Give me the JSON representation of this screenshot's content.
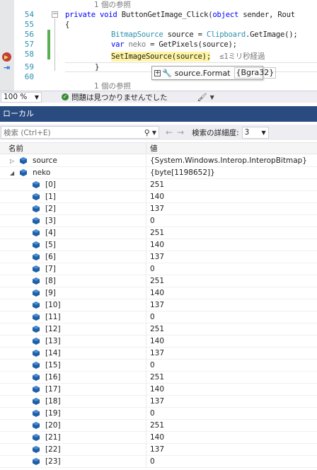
{
  "editor": {
    "ref_label_top": "1 個の参照",
    "ref_label_bottom": "1 個の参照",
    "line_numbers": [
      "54",
      "55",
      "56",
      "57",
      "58",
      "59",
      "60"
    ],
    "code": {
      "l54": {
        "kw1": "private",
        "kw2": "void",
        "name": " ButtonGetImage_Click(",
        "kw3": "object",
        "rest": " sender, Rout"
      },
      "l55": "{",
      "l56": {
        "type": "BitmapSource",
        "mid": " source = ",
        "type2": "Clipboard",
        "rest": ".GetImage();"
      },
      "l57": {
        "kw": "var",
        "dimvar": " neko",
        "rest": " = GetPixels(source);"
      },
      "l58": {
        "code": "SetImageSource(source);",
        "perf": "  ≤1ミリ秒経過"
      },
      "l59": "}"
    },
    "tooltip": {
      "expression": "source.Format",
      "value": "{Bgra32}"
    }
  },
  "status_bar": {
    "zoom": "100 %",
    "issues_text": "問題は見つかりませんでした"
  },
  "locals": {
    "title": "ローカル",
    "search_placeholder": "検索 (Ctrl+E)",
    "search_depth_label": "検索の詳細度:",
    "search_depth_value": "3",
    "columns": {
      "name": "名前",
      "value": "値"
    },
    "rows": [
      {
        "name": "source",
        "value": "{System.Windows.Interop.InteropBitmap}"
      },
      {
        "name": "neko",
        "value": "{byte[1198652]}"
      },
      {
        "name": "[0]",
        "value": "251"
      },
      {
        "name": "[1]",
        "value": "140"
      },
      {
        "name": "[2]",
        "value": "137"
      },
      {
        "name": "[3]",
        "value": "0"
      },
      {
        "name": "[4]",
        "value": "251"
      },
      {
        "name": "[5]",
        "value": "140"
      },
      {
        "name": "[6]",
        "value": "137"
      },
      {
        "name": "[7]",
        "value": "0"
      },
      {
        "name": "[8]",
        "value": "251"
      },
      {
        "name": "[9]",
        "value": "140"
      },
      {
        "name": "[10]",
        "value": "137"
      },
      {
        "name": "[11]",
        "value": "0"
      },
      {
        "name": "[12]",
        "value": "251"
      },
      {
        "name": "[13]",
        "value": "140"
      },
      {
        "name": "[14]",
        "value": "137"
      },
      {
        "name": "[15]",
        "value": "0"
      },
      {
        "name": "[16]",
        "value": "251"
      },
      {
        "name": "[17]",
        "value": "140"
      },
      {
        "name": "[18]",
        "value": "137"
      },
      {
        "name": "[19]",
        "value": "0"
      },
      {
        "name": "[20]",
        "value": "251"
      },
      {
        "name": "[21]",
        "value": "140"
      },
      {
        "name": "[22]",
        "value": "137"
      },
      {
        "name": "[23]",
        "value": "0"
      }
    ]
  },
  "colors": {
    "title_bar": "#2a4b80",
    "keyword": "#0000ff",
    "type": "#2b91af",
    "current_statement": "#fff4a3"
  }
}
